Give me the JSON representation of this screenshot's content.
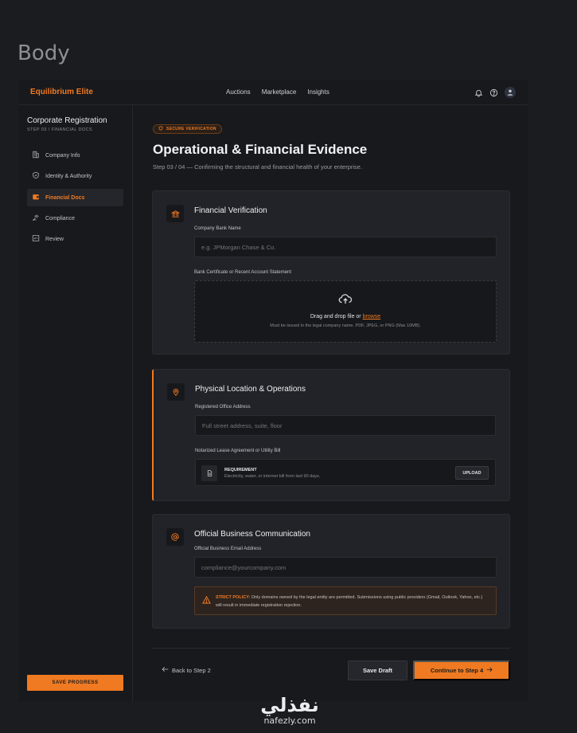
{
  "page_label": "Body",
  "colors": {
    "accent": "#f07a22",
    "background": "#18191c",
    "card": "#212328"
  },
  "topbar": {
    "brand": "Equilibrium Elite",
    "nav": [
      "Auctions",
      "Marketplace",
      "Insights"
    ],
    "icons": [
      "bell-icon",
      "help-icon",
      "avatar"
    ]
  },
  "sidebar": {
    "title": "Corporate Registration",
    "subtitle": "STEP 03 / FINANCIAL DOCS",
    "items": [
      {
        "label": "Company Info",
        "icon": "building-icon"
      },
      {
        "label": "Identity & Authority",
        "icon": "shield-icon"
      },
      {
        "label": "Financial Docs",
        "icon": "wallet-icon",
        "active": true
      },
      {
        "label": "Compliance",
        "icon": "gavel-icon"
      },
      {
        "label": "Review",
        "icon": "checklist-icon"
      }
    ],
    "save_progress": "SAVE PROGRESS"
  },
  "main": {
    "badge": "SECURE VERIFICATION",
    "title": "Operational & Financial Evidence",
    "subtitle": "Step 03 / 04 — Confirming the structural and financial health of your enterprise."
  },
  "financial": {
    "title": "Financial Verification",
    "bank_label": "Company Bank Name",
    "bank_placeholder": "e.g. JPMorgan Chase & Co.",
    "statement_label": "Bank Certificate or Recent Account Statement",
    "drop_text": "Drag and drop file or",
    "browse": "browse",
    "drop_sub": "Must be issued in the legal company name. PDF, JPEG, or PNG (Max 10MB)."
  },
  "location": {
    "title": "Physical Location & Operations",
    "address_label": "Registered Office Address",
    "address_placeholder": "Full street address, suite, floor",
    "lease_label": "Notarized Lease Agreement or Utility Bill",
    "req_title": "REQUIREMENT",
    "req_sub": "Electricity, water, or internet bill from last 90 days.",
    "upload": "UPLOAD"
  },
  "communication": {
    "title": "Official Business Communication",
    "email_label": "Official Business Email Address",
    "email_placeholder": "compliance@yourcompany.com",
    "policy_strong": "STRICT POLICY:",
    "policy_text": "Only domains owned by the legal entity are permitted. Submissions using public providers (Gmail, Outlook, Yahoo, etc.) will result in immediate registration rejection."
  },
  "footer": {
    "back": "Back to Step 2",
    "save_draft": "Save Draft",
    "continue": "Continue to Step 4"
  },
  "watermark": {
    "arabic": "نفذلي",
    "latin": "nafezly.com"
  }
}
